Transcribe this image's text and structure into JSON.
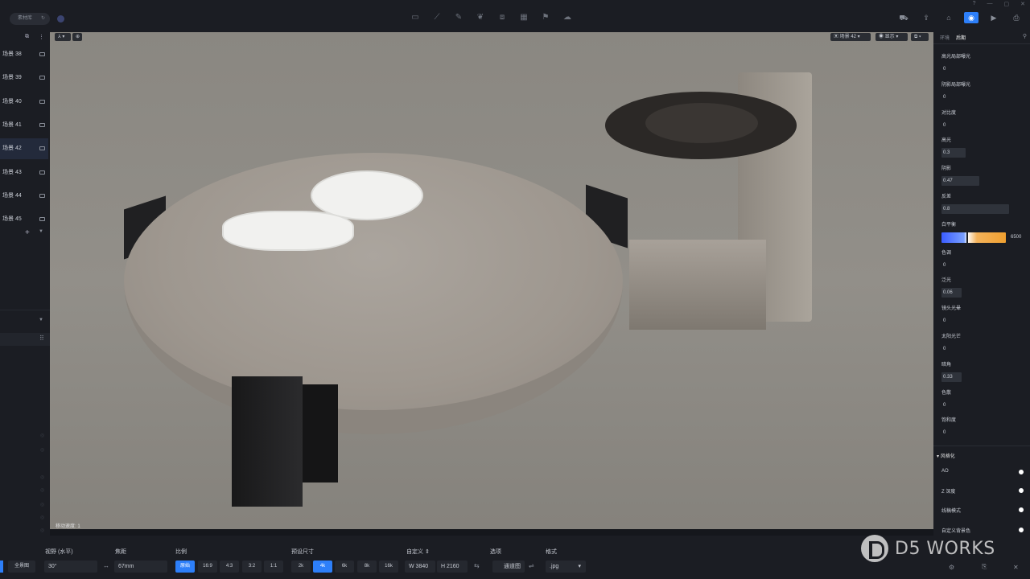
{
  "topbar": {
    "doc_tab": "素材库",
    "right_icons": [
      "render-image-icon",
      "share-icon",
      "gift-icon",
      "camera-icon",
      "video-icon",
      "export-icon"
    ]
  },
  "left_panel": {
    "scenes": [
      {
        "label": "场景 38",
        "active": false
      },
      {
        "label": "场景 39",
        "active": false
      },
      {
        "label": "场景 40",
        "active": false
      },
      {
        "label": "场景 41",
        "active": false
      },
      {
        "label": "场景 42",
        "active": true
      },
      {
        "label": "场景 43",
        "active": false
      },
      {
        "label": "场景 44",
        "active": false
      },
      {
        "label": "场景 45",
        "active": false
      }
    ]
  },
  "viewport": {
    "scene_selector": "场景 42",
    "display_label": "显示",
    "status": "移动速度: 1"
  },
  "right_panel": {
    "tabs": [
      "环境",
      "后期"
    ],
    "active_tab": "后期",
    "params": [
      {
        "label": "高光局部曝光",
        "value": "0",
        "level": 0
      },
      {
        "label": "阴影局部曝光",
        "value": "0",
        "level": 0
      },
      {
        "label": "对比度",
        "value": "0",
        "level": 0
      },
      {
        "label": "高光",
        "value": "0.3",
        "level": 0.36
      },
      {
        "label": "阴影",
        "value": "0.47",
        "level": 0.56
      },
      {
        "label": "反差",
        "value": "0.8",
        "level": 1.0
      },
      {
        "label": "白平衡",
        "value": "6500",
        "level": 0.4
      },
      {
        "label": "色调",
        "value": "0",
        "level": 0
      },
      {
        "label": "泛光",
        "value": "0.06",
        "level": 0.3
      },
      {
        "label": "镜头光晕",
        "value": "0",
        "level": 0
      },
      {
        "label": "太阳光芒",
        "value": "0",
        "level": 0
      },
      {
        "label": "暗角",
        "value": "0.33",
        "level": 0.3
      },
      {
        "label": "色散",
        "value": "0",
        "level": 0
      },
      {
        "label": "饱和度",
        "value": "0",
        "level": 0
      }
    ],
    "stylize": {
      "title": "风格化",
      "toggles": [
        "AO",
        "Z 深度",
        "线稿模式",
        "自定义背景色"
      ]
    }
  },
  "bottombar": {
    "fullscreen": "全景图",
    "fov_label": "视野 (水平)",
    "fov_value": "30°",
    "focal_label": "焦距",
    "focal_value": "67mm",
    "ratio_label": "比例",
    "ratios": [
      "原始",
      "16:9",
      "4:3",
      "3:2",
      "1:1"
    ],
    "active_ratio": "原始",
    "preset_label": "预设尺寸",
    "presets": [
      "2k",
      "4k",
      "6k",
      "8k",
      "16k"
    ],
    "active_preset": "4k",
    "custom_label": "自定义",
    "width": "W  3840",
    "height": "H  2160",
    "options_label": "选项",
    "channel": "通道图",
    "format_label": "格式",
    "format_value": ".jpg"
  },
  "watermark": {
    "text": "D5 WORKS"
  }
}
